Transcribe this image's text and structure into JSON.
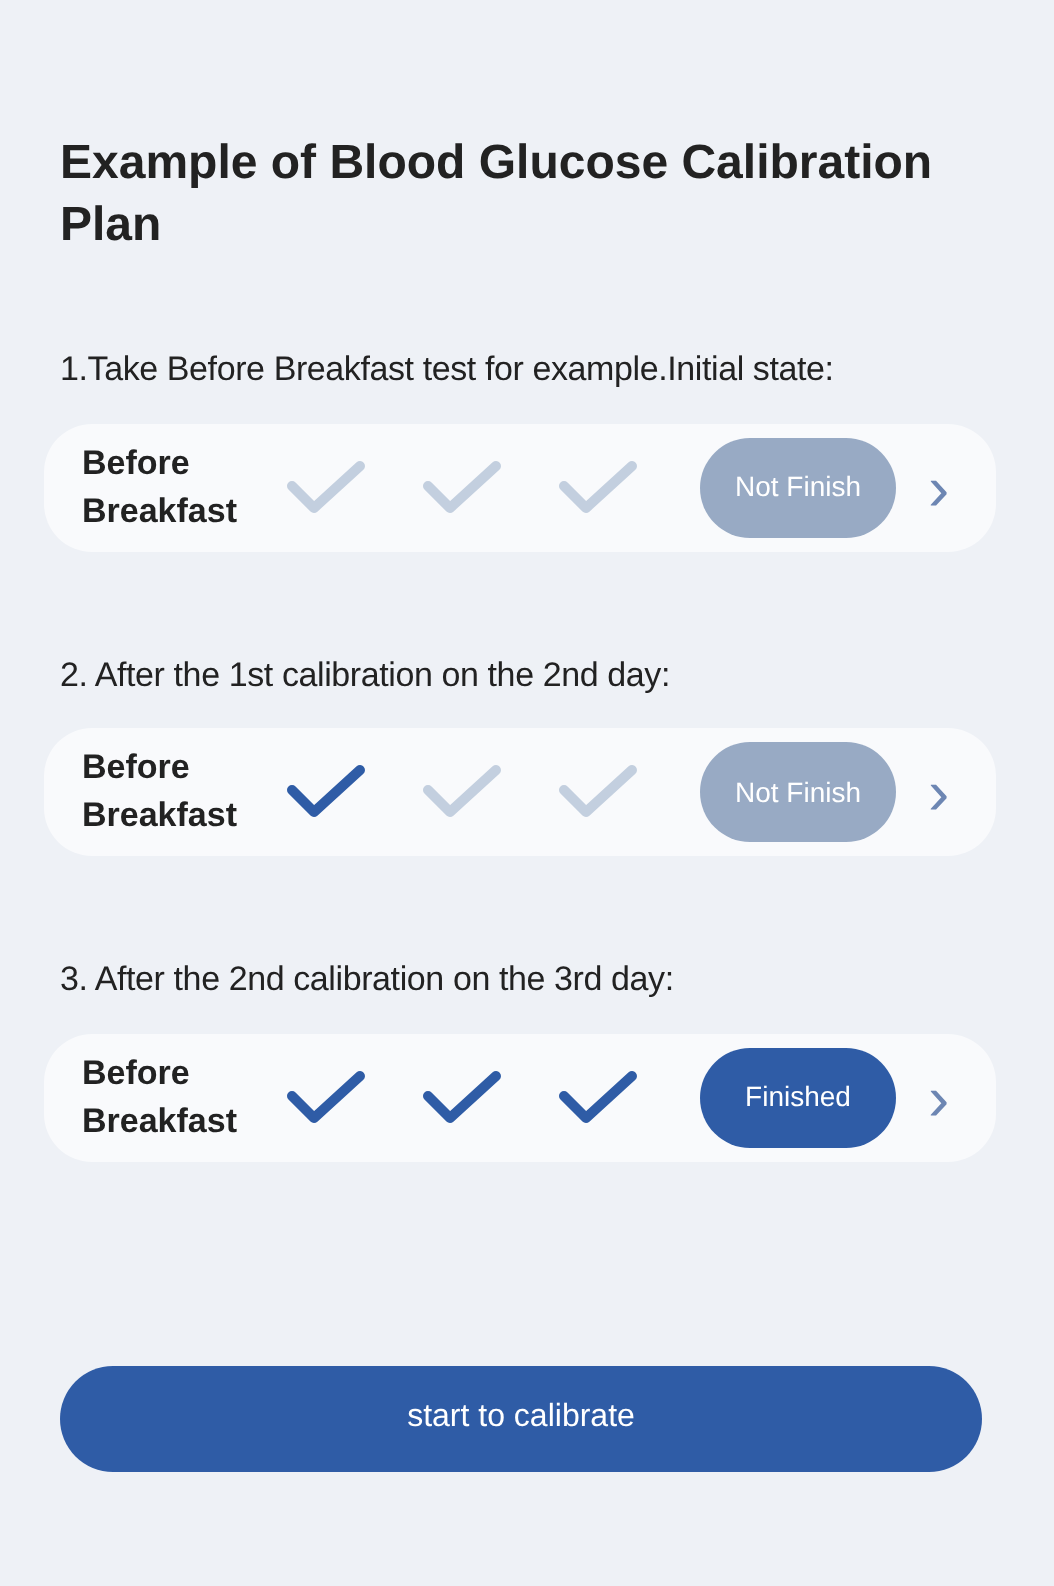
{
  "title": "Example of Blood Glucose Calibration Plan",
  "steps": [
    {
      "caption": "1.Take Before Breakfast test for example.Initial state:",
      "label": "Before Breakfast",
      "checks": [
        {
          "checked": false
        },
        {
          "checked": false
        },
        {
          "checked": false
        }
      ],
      "status": {
        "text": "Not Finish",
        "finished": false
      },
      "arrow": "›"
    },
    {
      "caption": "2. After the 1st calibration on the 2nd day:",
      "label": "Before Breakfast",
      "checks": [
        {
          "checked": true
        },
        {
          "checked": false
        },
        {
          "checked": false
        }
      ],
      "status": {
        "text": "Not Finish",
        "finished": false
      },
      "arrow": "›"
    },
    {
      "caption": "3. After the 2nd calibration on the 3rd day:",
      "label": "Before Breakfast",
      "checks": [
        {
          "checked": true
        },
        {
          "checked": true
        },
        {
          "checked": true
        }
      ],
      "status": {
        "text": "Finished",
        "finished": true
      },
      "arrow": "›"
    }
  ],
  "button": "start to calibrate"
}
